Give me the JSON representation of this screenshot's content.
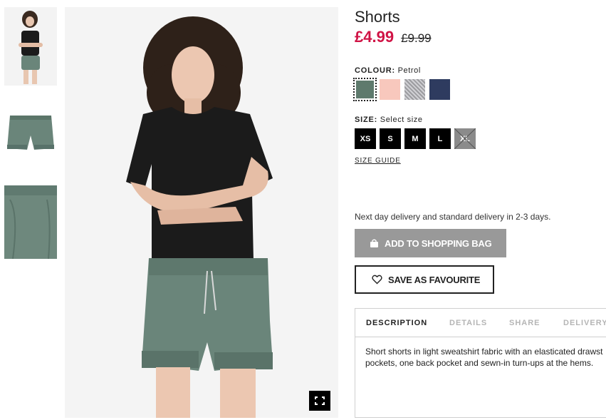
{
  "product": {
    "title": "Shorts",
    "price_now": "£4.99",
    "price_old": "£9.99"
  },
  "colour": {
    "label": "COLOUR:",
    "selected": "Petrol",
    "swatches": [
      {
        "name": "Petrol",
        "color": "#5e7a6d"
      },
      {
        "name": "Light pink",
        "color": "#f8c8bd"
      },
      {
        "name": "Grey marl",
        "color": "#b8b8bc"
      },
      {
        "name": "Dark blue",
        "color": "#2e3b5f"
      }
    ]
  },
  "size": {
    "label": "SIZE:",
    "prompt": "Select size",
    "options": [
      "XS",
      "S",
      "M",
      "L",
      "XL"
    ],
    "unavailable": [
      "XL"
    ],
    "guide": "SIZE GUIDE"
  },
  "delivery_note": "Next day delivery and standard delivery in 2-3 days.",
  "actions": {
    "add_to_bag": "ADD TO SHOPPING BAG",
    "save_favourite": "SAVE AS FAVOURITE"
  },
  "tabs": [
    "DESCRIPTION",
    "DETAILS",
    "SHARE",
    "DELIVERY"
  ],
  "active_tab": "DESCRIPTION",
  "description": {
    "line1": "Short shorts in light sweatshirt fabric with an elasticated drawst",
    "line2": "pockets, one back pocket and sewn-in turn-ups at the hems."
  },
  "icons": {
    "bag": "shopping-bag-icon",
    "heart": "heart-icon",
    "fullscreen": "fullscreen-icon"
  },
  "colors": {
    "sale_red": "#d01345",
    "add_bag_grey": "#999999",
    "shorts_green": "#5e7a6d"
  }
}
